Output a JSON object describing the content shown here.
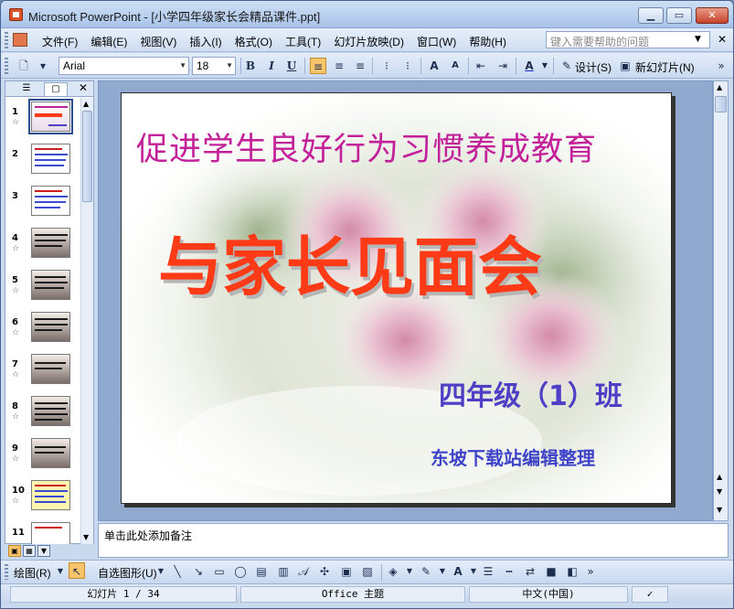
{
  "window": {
    "title": "Microsoft PowerPoint - [小学四年级家长会精品课件.ppt]"
  },
  "menu": {
    "items": [
      "文件(F)",
      "编辑(E)",
      "视图(V)",
      "插入(I)",
      "格式(O)",
      "工具(T)",
      "幻灯片放映(D)",
      "窗口(W)",
      "帮助(H)"
    ],
    "help_placeholder": "键入需要帮助的问题"
  },
  "toolbar": {
    "font": "Arial",
    "size": "18",
    "bold": "B",
    "italic": "I",
    "underline": "U",
    "design_label": "设计(S)",
    "new_slide_label": "新幻灯片(N)"
  },
  "slides": {
    "numbers": [
      "1",
      "2",
      "3",
      "4",
      "5",
      "6",
      "7",
      "8",
      "9",
      "10",
      "11"
    ]
  },
  "slide": {
    "title_line1": "促进学生良好行为习惯养成教育",
    "title_line2": "与家长见面会",
    "subtitle1": "四年级（1）班",
    "subtitle2": "东坡下载站编辑整理"
  },
  "notes": {
    "placeholder": "单击此处添加备注"
  },
  "drawbar": {
    "draw_label": "绘图(R)",
    "autoshape_label": "自选图形(U)"
  },
  "status": {
    "slide_counter": "幻灯片 1 / 34",
    "theme": "Office 主题",
    "language": "中文(中国)"
  },
  "colors": {
    "title1": "#c2219a",
    "title2": "#ff3a16",
    "subtitle": "#4f3fc7"
  }
}
